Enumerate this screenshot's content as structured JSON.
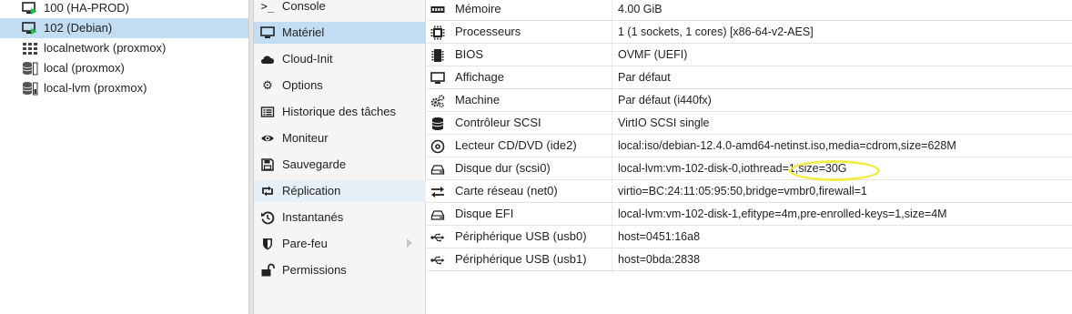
{
  "tree": {
    "items": [
      {
        "label": "100 (HA-PROD)",
        "icon": "vm-running-icon"
      },
      {
        "label": "102 (Debian)",
        "icon": "vm-running-icon"
      },
      {
        "label": "localnetwork (proxmox)",
        "icon": "network-grid-icon"
      },
      {
        "label": "local (proxmox)",
        "icon": "storage-icon"
      },
      {
        "label": "local-lvm (proxmox)",
        "icon": "storage-icon"
      }
    ]
  },
  "vm_nav": {
    "items": [
      {
        "label": "Console",
        "icon": "terminal-icon"
      },
      {
        "label": "Matériel",
        "icon": "monitor-icon"
      },
      {
        "label": "Cloud-Init",
        "icon": "cloud-icon"
      },
      {
        "label": "Options",
        "icon": "gear-icon"
      },
      {
        "label": "Historique des tâches",
        "icon": "list-icon"
      },
      {
        "label": "Moniteur",
        "icon": "eye-icon"
      },
      {
        "label": "Sauvegarde",
        "icon": "floppy-icon"
      },
      {
        "label": "Réplication",
        "icon": "retweet-icon"
      },
      {
        "label": "Instantanés",
        "icon": "history-icon"
      },
      {
        "label": "Pare-feu",
        "icon": "shield-icon"
      },
      {
        "label": "Permissions",
        "icon": "unlock-icon"
      }
    ]
  },
  "hardware": {
    "rows": [
      {
        "name": "Mémoire",
        "value": "4.00 GiB",
        "icon": "memory-icon"
      },
      {
        "name": "Processeurs",
        "value": "1 (1 sockets, 1 cores) [x86-64-v2-AES]",
        "icon": "cpu-icon"
      },
      {
        "name": "BIOS",
        "value": "OVMF (UEFI)",
        "icon": "microchip-icon"
      },
      {
        "name": "Affichage",
        "value": "Par défaut",
        "icon": "display-icon"
      },
      {
        "name": "Machine",
        "value": "Par défaut (i440fx)",
        "icon": "cogs-icon"
      },
      {
        "name": "Contrôleur SCSI",
        "value": "VirtIO SCSI single",
        "icon": "database-icon"
      },
      {
        "name": "Lecteur CD/DVD (ide2)",
        "value": "local:iso/debian-12.4.0-amd64-netinst.iso,media=cdrom,size=628M",
        "icon": "cdrom-icon"
      },
      {
        "name": "Disque dur (scsi0)",
        "value": "local-lvm:vm-102-disk-0,iothread=1,size=30G",
        "icon": "hdd-icon"
      },
      {
        "name": "Carte réseau (net0)",
        "value": "virtio=BC:24:11:05:95:50,bridge=vmbr0,firewall=1",
        "icon": "exchange-icon"
      },
      {
        "name": "Disque EFI",
        "value": "local-lvm:vm-102-disk-1,efitype=4m,pre-enrolled-keys=1,size=4M",
        "icon": "hdd-icon"
      },
      {
        "name": "Périphérique USB (usb0)",
        "value": "host=0451:16a8",
        "icon": "usb-icon"
      },
      {
        "name": "Périphérique USB (usb1)",
        "value": "host=0bda:2838",
        "icon": "usb-icon"
      }
    ]
  },
  "colors": {
    "selected": "#c2ddf2",
    "running": "#21bf4b",
    "highlight": "#f0ea33"
  }
}
